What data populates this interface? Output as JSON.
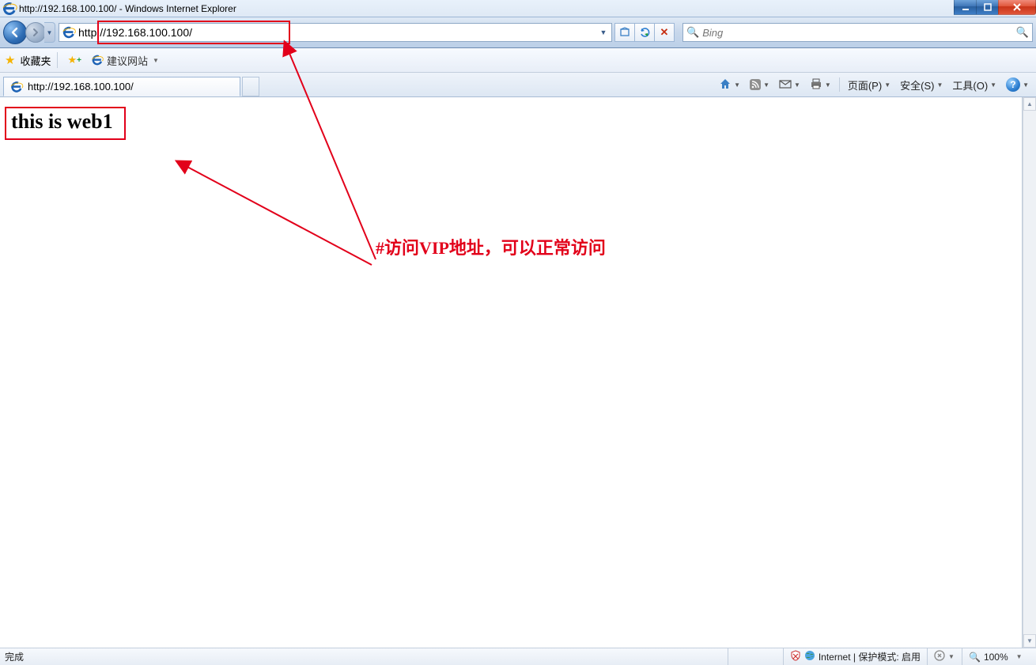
{
  "window": {
    "title": "http://192.168.100.100/ - Windows Internet Explorer"
  },
  "nav": {
    "url": "http://192.168.100.100/",
    "search_placeholder": "Bing"
  },
  "favbar": {
    "favorites_label": "收藏夹",
    "suggested_sites_label": "建议网站"
  },
  "tab": {
    "title": "http://192.168.100.100/"
  },
  "commands": {
    "page": "页面(P)",
    "safety": "安全(S)",
    "tools": "工具(O)"
  },
  "page": {
    "heading": "this is web1"
  },
  "annotation": {
    "text": "#访问VIP地址，可以正常访问"
  },
  "status": {
    "done": "完成",
    "zone": "Internet | 保护模式: 启用",
    "zoom": "100%"
  }
}
